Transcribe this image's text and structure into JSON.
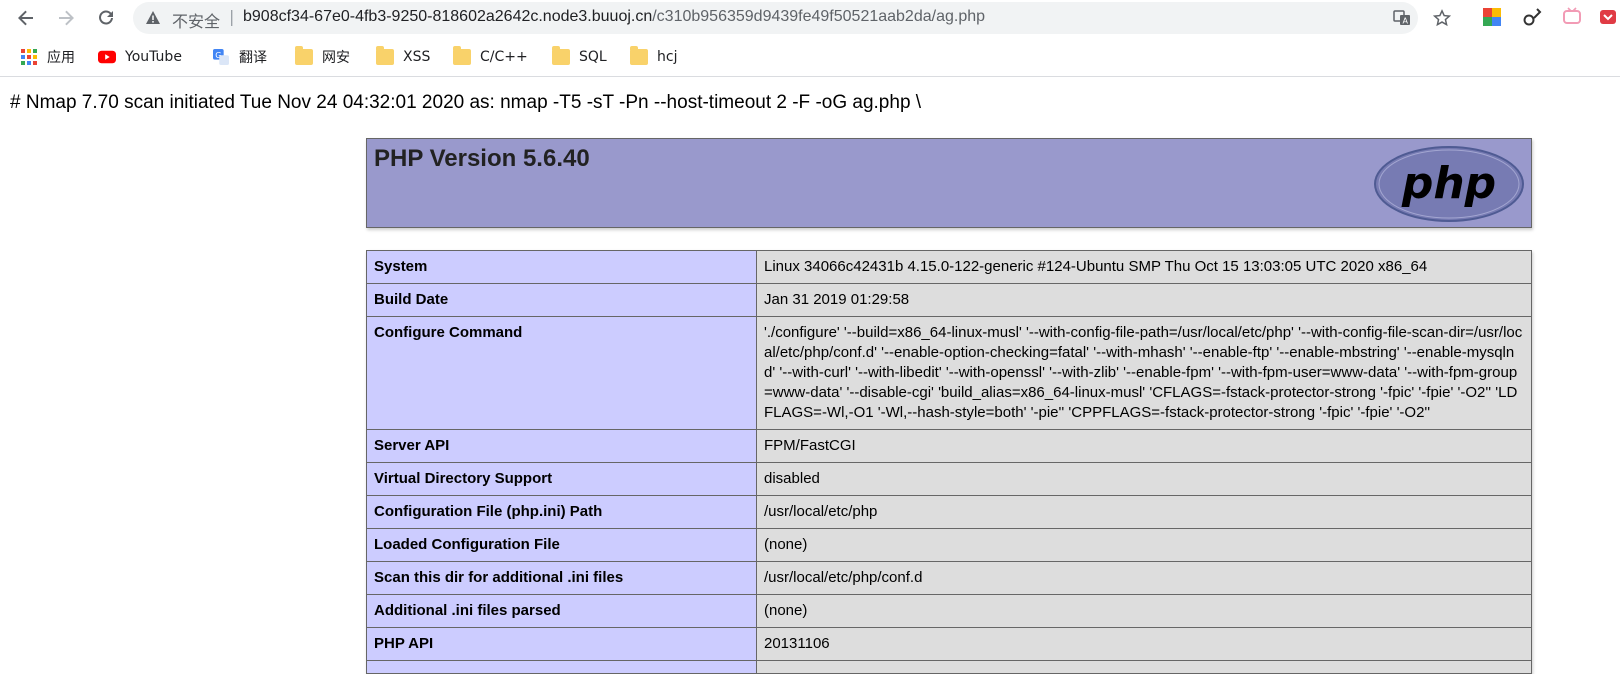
{
  "browser": {
    "security_label": "不安全",
    "separator": "|",
    "url_host": "b908cf34-67e0-4fb3-9250-818602a2642c.node3.buuoj.cn",
    "url_path": "/c310b956359d9439fe49f50521aab2da/ag.php"
  },
  "bookmarks": [
    {
      "label": "应用",
      "icon": "apps-grid-icon"
    },
    {
      "label": "YouTube",
      "icon": "youtube-icon"
    },
    {
      "label": "翻译",
      "icon": "google-translate-icon"
    },
    {
      "label": "网安",
      "icon": "folder-icon"
    },
    {
      "label": "XSS",
      "icon": "folder-icon"
    },
    {
      "label": "C/C++",
      "icon": "folder-icon"
    },
    {
      "label": "SQL",
      "icon": "folder-icon"
    },
    {
      "label": "hcj",
      "icon": "folder-icon"
    }
  ],
  "page": {
    "nmap_line": "# Nmap 7.70 scan initiated Tue Nov 24 04:32:01 2020 as: nmap -T5 -sT -Pn --host-timeout 2 -F -oG ag.php \\",
    "php_title": "PHP Version 5.6.40",
    "logo_text": "php",
    "rows": [
      {
        "key": "System",
        "value": "Linux 34066c42431b 4.15.0-122-generic #124-Ubuntu SMP Thu Oct 15 13:03:05 UTC 2020 x86_64"
      },
      {
        "key": "Build Date",
        "value": "Jan 31 2019 01:29:58"
      },
      {
        "key": "Configure Command",
        "value": "'./configure' '--build=x86_64-linux-musl' '--with-config-file-path=/usr/local/etc/php' '--with-config-file-scan-dir=/usr/local/etc/php/conf.d' '--enable-option-checking=fatal' '--with-mhash' '--enable-ftp' '--enable-mbstring' '--enable-mysqlnd' '--with-curl' '--with-libedit' '--with-openssl' '--with-zlib' '--enable-fpm' '--with-fpm-user=www-data' '--with-fpm-group=www-data' '--disable-cgi' 'build_alias=x86_64-linux-musl' 'CFLAGS=-fstack-protector-strong '-fpic' '-fpie' '-O2'' 'LDFLAGS=-Wl,-O1 '-Wl,--hash-style=both' '-pie'' 'CPPFLAGS=-fstack-protector-strong '-fpic' '-fpie' '-O2''"
      },
      {
        "key": "Server API",
        "value": "FPM/FastCGI"
      },
      {
        "key": "Virtual Directory Support",
        "value": "disabled"
      },
      {
        "key": "Configuration File (php.ini) Path",
        "value": "/usr/local/etc/php"
      },
      {
        "key": "Loaded Configuration File",
        "value": "(none)"
      },
      {
        "key": "Scan this dir for additional .ini files",
        "value": "/usr/local/etc/php/conf.d"
      },
      {
        "key": "Additional .ini files parsed",
        "value": "(none)"
      },
      {
        "key": "PHP API",
        "value": "20131106"
      },
      {
        "key": "",
        "value": ""
      }
    ]
  },
  "colors": {
    "header_bg": "#9999cc",
    "key_cell_bg": "#ccccff",
    "value_cell_bg": "#dddddd"
  }
}
